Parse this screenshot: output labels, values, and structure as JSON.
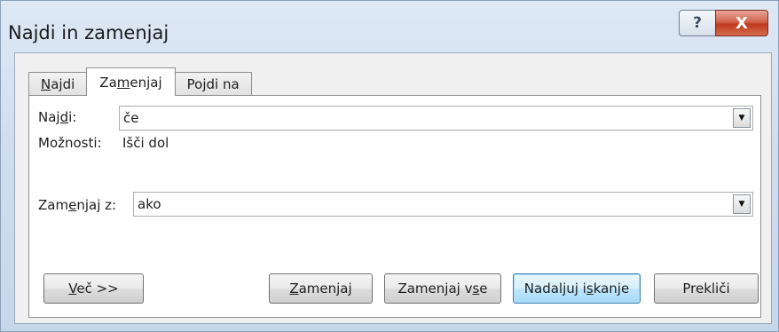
{
  "window": {
    "title": "Najdi in zamenjaj",
    "help_glyph": "?",
    "close_glyph": "X"
  },
  "tabs": [
    {
      "pre": "",
      "key": "N",
      "post": "ajdi"
    },
    {
      "pre": "Za",
      "key": "m",
      "post": "enjaj"
    },
    {
      "pre": "Po",
      "key": "j",
      "post": "di na"
    }
  ],
  "find": {
    "label_pre": "Naj",
    "label_key": "d",
    "label_post": "i:",
    "value": "če",
    "options_label": "Možnosti:",
    "options_value": "Išči dol"
  },
  "replace": {
    "label_pre": "Zam",
    "label_key": "e",
    "label_post": "njaj z:",
    "value": "ako"
  },
  "buttons": {
    "more": {
      "pre": "",
      "key": "V",
      "post": "eč >>"
    },
    "replace": {
      "pre": "",
      "key": "Z",
      "post": "amenjaj"
    },
    "replace_all": {
      "pre": "Zamenjaj v",
      "key": "s",
      "post": "e"
    },
    "find_next": {
      "pre": "Nadaljuj i",
      "key": "s",
      "post": "kanje"
    },
    "cancel": {
      "label": "Prekliči"
    }
  },
  "icons": {
    "dropdown_arrow": "▼"
  }
}
